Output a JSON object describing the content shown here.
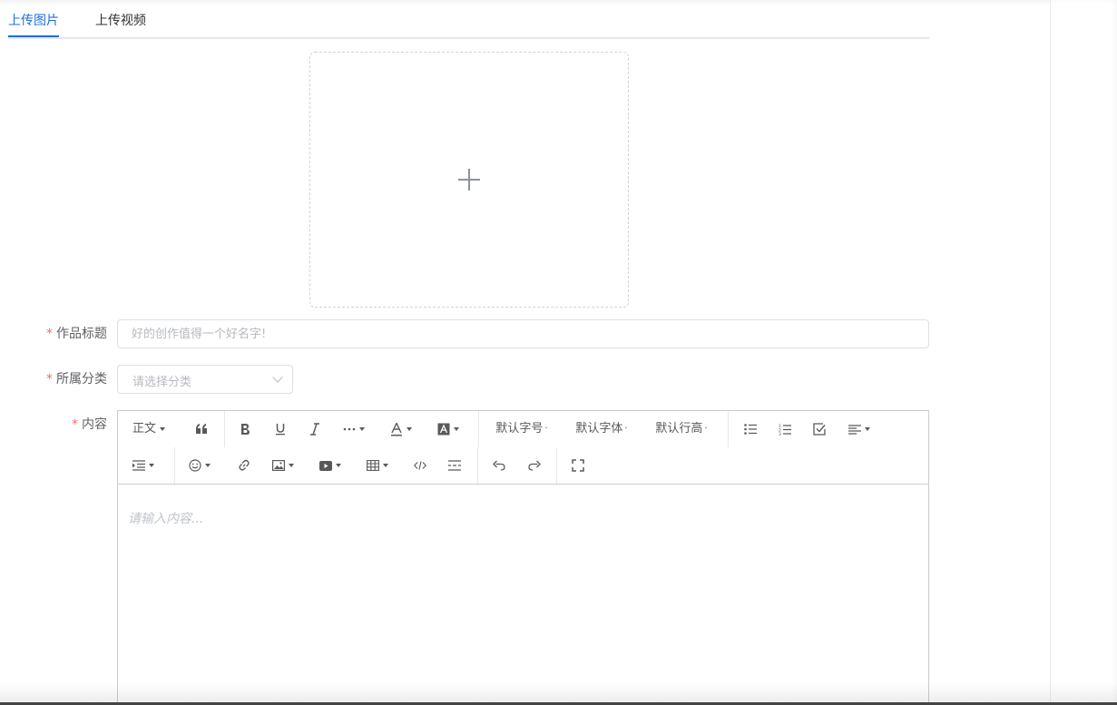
{
  "tabs": [
    {
      "label": "上传图片",
      "active": true
    },
    {
      "label": "上传视频",
      "active": false
    }
  ],
  "uploader": {
    "icon": "plus-icon"
  },
  "form": {
    "title_label": "作品标题",
    "title_placeholder": "好的创作值得一个好名字!",
    "category_label": "所属分类",
    "category_placeholder": "请选择分类",
    "content_label": "内容",
    "required_mark": "*"
  },
  "editor": {
    "toolbar": {
      "paragraph": "正文",
      "font_size": "默认字号",
      "font_family": "默认字体",
      "line_height": "默认行高"
    },
    "placeholder": "请输入内容..."
  },
  "colors": {
    "accent": "#1f6fd6",
    "required": "#f56c6c",
    "placeholder": "#b6b9bf"
  }
}
